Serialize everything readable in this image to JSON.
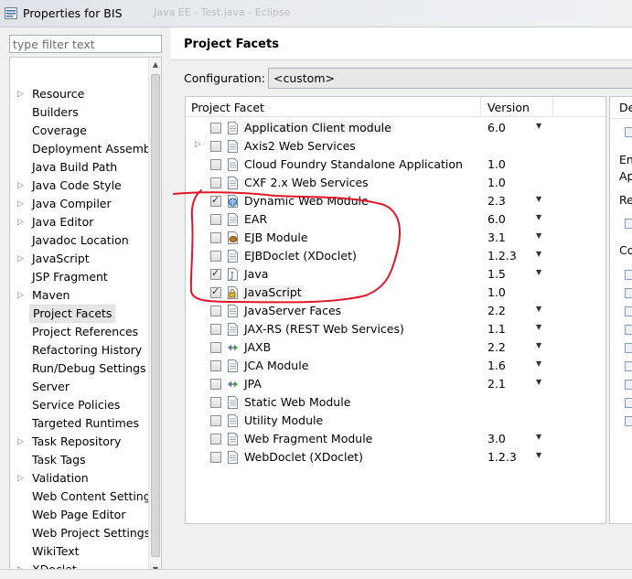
{
  "window": {
    "title": "Properties for BIS",
    "ghost_title": "Java EE - Test.java - Eclipse"
  },
  "sidebar": {
    "filter_placeholder": "type filter text",
    "items": [
      {
        "label": "Resource",
        "expandable": true
      },
      {
        "label": "Builders",
        "expandable": false
      },
      {
        "label": "Coverage",
        "expandable": false
      },
      {
        "label": "Deployment Assembly",
        "expandable": false
      },
      {
        "label": "Java Build Path",
        "expandable": false
      },
      {
        "label": "Java Code Style",
        "expandable": true
      },
      {
        "label": "Java Compiler",
        "expandable": true
      },
      {
        "label": "Java Editor",
        "expandable": true
      },
      {
        "label": "Javadoc Location",
        "expandable": false
      },
      {
        "label": "JavaScript",
        "expandable": true
      },
      {
        "label": "JSP Fragment",
        "expandable": false
      },
      {
        "label": "Maven",
        "expandable": true
      },
      {
        "label": "Project Facets",
        "expandable": false,
        "selected": true
      },
      {
        "label": "Project References",
        "expandable": false
      },
      {
        "label": "Refactoring History",
        "expandable": false
      },
      {
        "label": "Run/Debug Settings",
        "expandable": false
      },
      {
        "label": "Server",
        "expandable": false
      },
      {
        "label": "Service Policies",
        "expandable": false
      },
      {
        "label": "Targeted Runtimes",
        "expandable": false
      },
      {
        "label": "Task Repository",
        "expandable": true
      },
      {
        "label": "Task Tags",
        "expandable": false
      },
      {
        "label": "Validation",
        "expandable": true
      },
      {
        "label": "Web Content Settings",
        "expandable": false
      },
      {
        "label": "Web Page Editor",
        "expandable": false
      },
      {
        "label": "Web Project Settings",
        "expandable": false
      },
      {
        "label": "WikiText",
        "expandable": false
      },
      {
        "label": "XDoclet",
        "expandable": true
      }
    ]
  },
  "main": {
    "title": "Project Facets",
    "configuration_label": "Configuration:",
    "configuration_value": "<custom>",
    "columns": {
      "facet": "Project Facet",
      "version": "Version"
    },
    "facets": [
      {
        "name": "Application Client module",
        "version": "6.0",
        "checked": false,
        "dropdown": true,
        "expandable": false,
        "icon": "page-icon",
        "highlight": true
      },
      {
        "name": "Axis2 Web Services",
        "version": "",
        "checked": false,
        "dropdown": false,
        "expandable": true,
        "icon": "page-icon"
      },
      {
        "name": "Cloud Foundry Standalone Application",
        "version": "1.0",
        "checked": false,
        "dropdown": false,
        "expandable": false,
        "icon": "page-icon"
      },
      {
        "name": "CXF 2.x Web Services",
        "version": "1.0",
        "checked": false,
        "dropdown": false,
        "expandable": false,
        "icon": "page-icon"
      },
      {
        "name": "Dynamic Web Module",
        "version": "2.3",
        "checked": true,
        "dropdown": true,
        "expandable": false,
        "icon": "globe-page-icon"
      },
      {
        "name": "EAR",
        "version": "6.0",
        "checked": false,
        "dropdown": true,
        "expandable": false,
        "icon": "page-icon"
      },
      {
        "name": "EJB Module",
        "version": "3.1",
        "checked": false,
        "dropdown": true,
        "expandable": false,
        "icon": "bean-icon"
      },
      {
        "name": "EJBDoclet (XDoclet)",
        "version": "1.2.3",
        "checked": false,
        "dropdown": true,
        "expandable": false,
        "icon": "page-icon"
      },
      {
        "name": "Java",
        "version": "1.5",
        "checked": true,
        "dropdown": true,
        "expandable": false,
        "icon": "java-icon"
      },
      {
        "name": "JavaScript",
        "version": "1.0",
        "checked": true,
        "dropdown": false,
        "expandable": false,
        "icon": "lock-page-icon",
        "highlight": true
      },
      {
        "name": "JavaServer Faces",
        "version": "2.2",
        "checked": false,
        "dropdown": true,
        "expandable": false,
        "icon": "page-icon"
      },
      {
        "name": "JAX-RS (REST Web Services)",
        "version": "1.1",
        "checked": false,
        "dropdown": true,
        "expandable": false,
        "icon": "page-icon"
      },
      {
        "name": "JAXB",
        "version": "2.2",
        "checked": false,
        "dropdown": true,
        "expandable": false,
        "icon": "arrows-icon"
      },
      {
        "name": "JCA Module",
        "version": "1.6",
        "checked": false,
        "dropdown": true,
        "expandable": false,
        "icon": "page-icon"
      },
      {
        "name": "JPA",
        "version": "2.1",
        "checked": false,
        "dropdown": true,
        "expandable": false,
        "icon": "arrows-icon"
      },
      {
        "name": "Static Web Module",
        "version": "",
        "checked": false,
        "dropdown": false,
        "expandable": false,
        "icon": "page-icon"
      },
      {
        "name": "Utility Module",
        "version": "",
        "checked": false,
        "dropdown": false,
        "expandable": false,
        "icon": "page-icon"
      },
      {
        "name": "Web Fragment Module",
        "version": "3.0",
        "checked": false,
        "dropdown": true,
        "expandable": false,
        "icon": "page-icon"
      },
      {
        "name": "WebDoclet (XDoclet)",
        "version": "1.2.3",
        "checked": false,
        "dropdown": true,
        "expandable": false,
        "icon": "page-icon"
      }
    ]
  },
  "details": {
    "tab_label": "De",
    "text_1": "En",
    "text_2": "Ap",
    "text_3": "Re",
    "text_4": "Co"
  },
  "colors": {
    "annotation": "#e0172a",
    "selection": "#e5e5e5"
  }
}
